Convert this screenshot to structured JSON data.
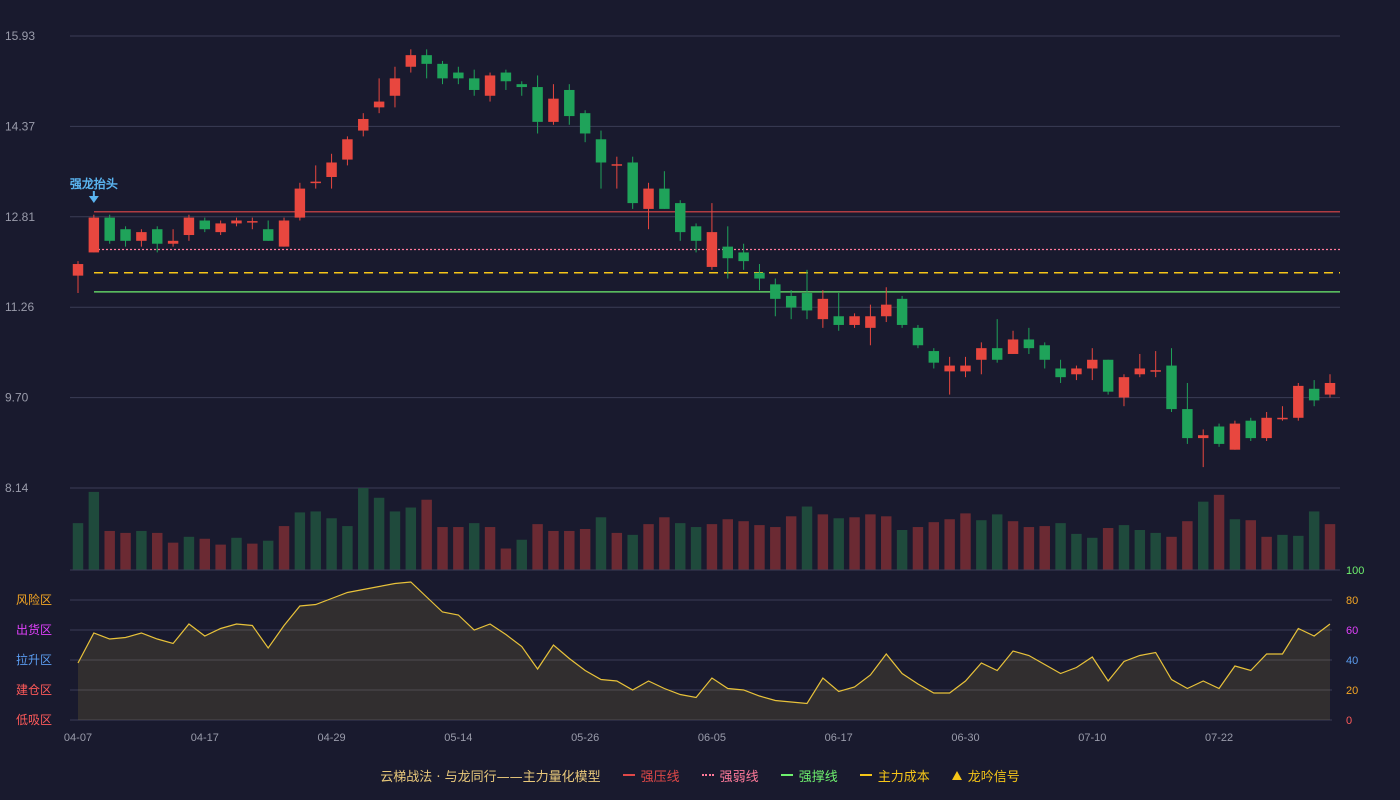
{
  "chart_data": {
    "type": "candlestick",
    "price_axis": {
      "ticks": [
        "15.93",
        "14.37",
        "12.81",
        "11.26",
        "9.70",
        "8.14"
      ],
      "min": 8.14,
      "max": 15.93
    },
    "x_tick_labels": [
      "04-07",
      "04-17",
      "04-29",
      "05-14",
      "05-26",
      "06-05",
      "06-17",
      "06-30",
      "07-10",
      "07-22"
    ],
    "x_tick_indices": [
      0,
      8,
      16,
      24,
      32,
      40,
      48,
      56,
      64,
      72
    ],
    "ohlc": [
      [
        11.8,
        12.0,
        11.5,
        12.05
      ],
      [
        12.2,
        12.8,
        12.2,
        12.85
      ],
      [
        12.8,
        12.4,
        12.35,
        12.85
      ],
      [
        12.6,
        12.4,
        12.3,
        12.65
      ],
      [
        12.4,
        12.55,
        12.3,
        12.6
      ],
      [
        12.6,
        12.35,
        12.2,
        12.65
      ],
      [
        12.35,
        12.4,
        12.3,
        12.6
      ],
      [
        12.5,
        12.8,
        12.4,
        12.85
      ],
      [
        12.75,
        12.6,
        12.55,
        12.8
      ],
      [
        12.55,
        12.7,
        12.5,
        12.75
      ],
      [
        12.7,
        12.75,
        12.65,
        12.8
      ],
      [
        12.72,
        12.74,
        12.6,
        12.8
      ],
      [
        12.6,
        12.4,
        12.4,
        12.75
      ],
      [
        12.3,
        12.75,
        12.3,
        12.8
      ],
      [
        12.8,
        13.3,
        12.75,
        13.4
      ],
      [
        13.4,
        13.42,
        13.3,
        13.7
      ],
      [
        13.5,
        13.75,
        13.3,
        13.9
      ],
      [
        13.8,
        14.15,
        13.7,
        14.2
      ],
      [
        14.3,
        14.5,
        14.2,
        14.6
      ],
      [
        14.7,
        14.8,
        14.6,
        15.2
      ],
      [
        14.9,
        15.2,
        14.7,
        15.4
      ],
      [
        15.4,
        15.6,
        15.3,
        15.7
      ],
      [
        15.6,
        15.45,
        15.2,
        15.7
      ],
      [
        15.45,
        15.2,
        15.1,
        15.5
      ],
      [
        15.3,
        15.2,
        15.1,
        15.4
      ],
      [
        15.2,
        15.0,
        14.9,
        15.35
      ],
      [
        14.9,
        15.25,
        14.8,
        15.3
      ],
      [
        15.3,
        15.15,
        15.0,
        15.35
      ],
      [
        15.1,
        15.05,
        14.9,
        15.15
      ],
      [
        15.05,
        14.45,
        14.25,
        15.25
      ],
      [
        14.45,
        14.85,
        14.4,
        15.1
      ],
      [
        15.0,
        14.55,
        14.4,
        15.1
      ],
      [
        14.6,
        14.25,
        14.1,
        14.65
      ],
      [
        14.15,
        13.75,
        13.3,
        14.3
      ],
      [
        13.7,
        13.72,
        13.3,
        13.85
      ],
      [
        13.75,
        13.05,
        12.95,
        13.85
      ],
      [
        12.95,
        13.3,
        12.6,
        13.4
      ],
      [
        13.3,
        12.95,
        12.95,
        13.6
      ],
      [
        13.05,
        12.55,
        12.4,
        13.1
      ],
      [
        12.65,
        12.4,
        12.2,
        12.7
      ],
      [
        11.95,
        12.55,
        11.9,
        13.05
      ],
      [
        12.3,
        12.1,
        11.75,
        12.65
      ],
      [
        12.2,
        12.05,
        11.9,
        12.35
      ],
      [
        11.85,
        11.75,
        11.55,
        12.0
      ],
      [
        11.65,
        11.4,
        11.1,
        11.75
      ],
      [
        11.45,
        11.25,
        11.05,
        11.55
      ],
      [
        11.5,
        11.2,
        11.05,
        11.9
      ],
      [
        11.05,
        11.4,
        10.9,
        11.55
      ],
      [
        11.1,
        10.95,
        10.85,
        11.5
      ],
      [
        10.95,
        11.1,
        10.9,
        11.15
      ],
      [
        10.9,
        11.1,
        10.6,
        11.3
      ],
      [
        11.1,
        11.3,
        11.0,
        11.6
      ],
      [
        11.4,
        10.95,
        10.9,
        11.45
      ],
      [
        10.9,
        10.6,
        10.55,
        10.95
      ],
      [
        10.5,
        10.3,
        10.2,
        10.55
      ],
      [
        10.15,
        10.25,
        9.75,
        10.4
      ],
      [
        10.15,
        10.25,
        10.05,
        10.4
      ],
      [
        10.35,
        10.55,
        10.1,
        10.65
      ],
      [
        10.55,
        10.35,
        10.3,
        11.05
      ],
      [
        10.45,
        10.7,
        10.45,
        10.85
      ],
      [
        10.7,
        10.55,
        10.45,
        10.9
      ],
      [
        10.6,
        10.35,
        10.2,
        10.65
      ],
      [
        10.2,
        10.05,
        9.95,
        10.35
      ],
      [
        10.1,
        10.2,
        10.0,
        10.25
      ],
      [
        10.2,
        10.35,
        10.0,
        10.55
      ],
      [
        10.35,
        9.8,
        9.75,
        10.35
      ],
      [
        9.7,
        10.05,
        9.55,
        10.1
      ],
      [
        10.1,
        10.2,
        10.05,
        10.45
      ],
      [
        10.15,
        10.17,
        10.05,
        10.5
      ],
      [
        10.25,
        9.5,
        9.45,
        10.55
      ],
      [
        9.5,
        9.0,
        8.9,
        9.95
      ],
      [
        9.0,
        9.05,
        8.5,
        9.15
      ],
      [
        9.2,
        8.9,
        8.85,
        9.25
      ],
      [
        8.8,
        9.25,
        8.8,
        9.3
      ],
      [
        9.3,
        9.0,
        8.95,
        9.35
      ],
      [
        9.0,
        9.35,
        8.95,
        9.45
      ],
      [
        9.35,
        9.35,
        9.3,
        9.55
      ],
      [
        9.35,
        9.9,
        9.3,
        9.95
      ],
      [
        9.85,
        9.65,
        9.55,
        10.0
      ],
      [
        9.75,
        9.95,
        9.7,
        10.1
      ]
    ],
    "volume_colors": [
      "g",
      "g",
      "r",
      "r",
      "g",
      "r",
      "r",
      "g",
      "r",
      "r",
      "g",
      "r",
      "g",
      "r",
      "g",
      "g",
      "g",
      "g",
      "g",
      "g",
      "g",
      "g",
      "r",
      "r",
      "r",
      "g",
      "r",
      "r",
      "g",
      "r",
      "r",
      "r",
      "r",
      "g",
      "r",
      "g",
      "r",
      "r",
      "g",
      "g",
      "r",
      "r",
      "r",
      "r",
      "r",
      "r",
      "g",
      "r",
      "g",
      "r",
      "r",
      "r",
      "g",
      "r",
      "r",
      "r",
      "r",
      "g",
      "g",
      "r",
      "r",
      "r",
      "g",
      "g",
      "g",
      "r",
      "g",
      "g",
      "g",
      "r",
      "r",
      "g",
      "r",
      "g",
      "r",
      "r",
      "g",
      "g",
      "g",
      "r",
      "g"
    ],
    "volume_values": [
      48,
      80,
      40,
      38,
      40,
      38,
      28,
      34,
      32,
      26,
      33,
      27,
      30,
      45,
      59,
      60,
      53,
      45,
      84,
      74,
      60,
      64,
      72,
      44,
      44,
      48,
      44,
      22,
      31,
      47,
      40,
      40,
      42,
      54,
      38,
      36,
      47,
      54,
      48,
      44,
      47,
      52,
      50,
      46,
      44,
      55,
      65,
      57,
      53,
      54,
      57,
      55,
      41,
      44,
      49,
      52,
      58,
      51,
      57,
      50,
      44,
      45,
      48,
      37,
      33,
      43,
      46,
      41,
      38,
      34,
      50,
      70,
      77,
      52,
      51,
      34,
      36,
      35,
      60,
      47,
      36
    ],
    "oscillator": {
      "axis_right": [
        "100",
        "80",
        "60",
        "40",
        "20",
        "0"
      ],
      "zones": [
        "风险区",
        "出货区",
        "拉升区",
        "建仓区",
        "低吸区"
      ],
      "values": [
        38,
        58,
        54,
        55,
        58,
        54,
        51,
        64,
        56,
        61,
        64,
        63,
        48,
        63,
        76,
        77,
        81,
        85,
        87,
        89,
        91,
        92,
        82,
        72,
        70,
        60,
        64,
        57,
        49,
        34,
        50,
        41,
        33,
        27,
        26,
        20,
        26,
        21,
        17,
        15,
        28,
        21,
        20,
        16,
        13,
        12,
        11,
        28,
        19,
        22,
        30,
        44,
        31,
        24,
        18,
        18,
        26,
        38,
        33,
        46,
        43,
        37,
        31,
        35,
        42,
        26,
        39,
        43,
        45,
        27,
        21,
        26,
        21,
        36,
        33,
        44,
        44,
        61,
        56,
        64
      ]
    },
    "lines": {
      "strong_pressure": 12.9,
      "strong_weak": 12.25,
      "main_cost": 11.85,
      "strong_support": 11.52
    },
    "annotation": {
      "text": "强龙抬头",
      "index": 1
    }
  },
  "legend": {
    "title": "云梯战法 · 与龙同行——主力量化模型",
    "items": [
      {
        "label": "强压线",
        "color": "#e04848",
        "style": "solid"
      },
      {
        "label": "强弱线",
        "color": "#ff7a9a",
        "style": "dotted"
      },
      {
        "label": "强撑线",
        "color": "#6ef06e",
        "style": "solid"
      },
      {
        "label": "主力成本",
        "color": "#f5c518",
        "style": "dashed"
      },
      {
        "label": "龙吟信号",
        "color": "#f5c518",
        "style": "triangle"
      }
    ]
  },
  "colors": {
    "up": "#e8473f",
    "down": "#1fa35a",
    "vol_up": "#6b2a33",
    "vol_down": "#1f4a3c",
    "grid": "#3a3c55",
    "axis_text": "#9a9cab",
    "osc_line": "#e8c23a",
    "annotation": "#5ab4f0"
  }
}
